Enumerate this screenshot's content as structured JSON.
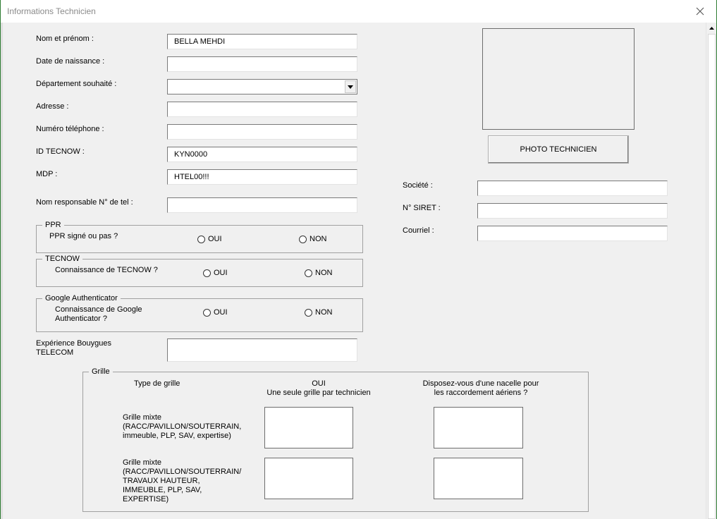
{
  "window": {
    "title": "Informations Technicien"
  },
  "form": {
    "nom_label": "Nom et prénom :",
    "nom_value": "BELLA MEHDI",
    "naissance_label": "Date de naissance :",
    "naissance_value": "",
    "departement_label": "Département souhaité :",
    "departement_value": "",
    "adresse_label": "Adresse :",
    "adresse_value": "",
    "telephone_label": "Numéro téléphone :",
    "telephone_value": "",
    "id_label": "ID TECNOW :",
    "id_value": "KYN0000",
    "mdp_label": "MDP :",
    "mdp_value": "HTEL00!!!",
    "responsable_label": "Nom responsable N° de tel :",
    "responsable_value": "",
    "experience_label": "Expérience Bouygues TELECOM",
    "experience_value": ""
  },
  "ppr": {
    "title": "PPR",
    "question": "PPR signé ou pas ?",
    "oui": "OUI",
    "non": "NON"
  },
  "tecnow": {
    "title": "TECNOW",
    "question": "Connaissance de TECNOW ?",
    "oui": "OUI",
    "non": "NON"
  },
  "google": {
    "title": "Google Authenticator",
    "question": "Connaissance de Google Authenticator ?",
    "oui": "OUI",
    "non": "NON"
  },
  "photo": {
    "button_label": "PHOTO TECHNICIEN"
  },
  "company": {
    "societe_label": "Société :",
    "societe_value": "",
    "siret_label": "N° SIRET :",
    "siret_value": "",
    "courriel_label": "Courriel :",
    "courriel_value": ""
  },
  "grille": {
    "title": "Grille",
    "col_type": "Type de grille",
    "col_oui": "OUI\nUne seule grille par technicien",
    "col_nacelle": "Disposez-vous d'une nacelle pour les raccordement aériens ?",
    "row1_label": "Grille mixte (RACC/PAVILLON/SOUTERRAIN, immeuble, PLP, SAV, expertise)",
    "row2_label": "Grille mixte (RACC/PAVILLON/SOUTERRAIN/ TRAVAUX HAUTEUR, IMMEUBLE, PLP, SAV, EXPERTISE)"
  }
}
